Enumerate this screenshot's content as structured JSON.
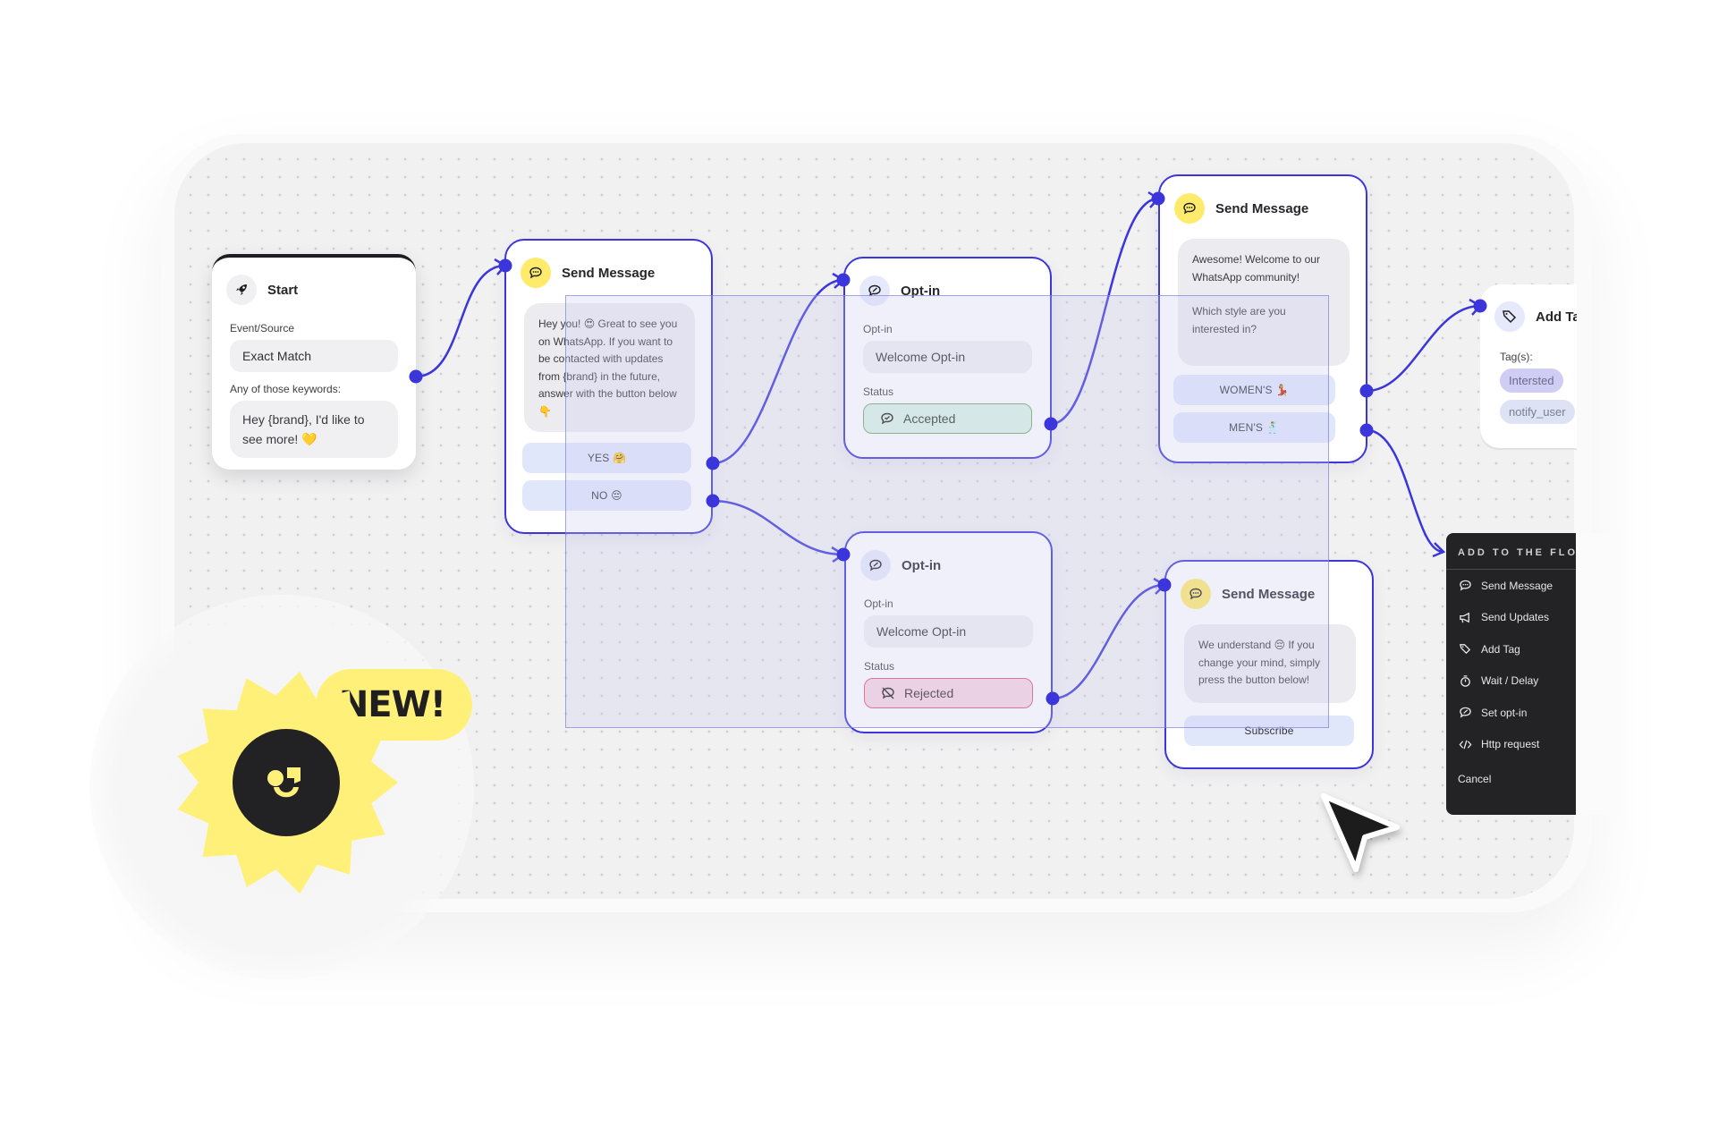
{
  "canvas": {
    "nodes": {
      "start": {
        "title": "Start",
        "icon": "rocket-icon",
        "event_label": "Event/Source",
        "event_value": "Exact Match",
        "keywords_label": "Any of those keywords:",
        "keyword_value": "Hey {brand}, I'd like to see more! 💛"
      },
      "send_message_1": {
        "title": "Send Message",
        "icon": "chat-bubble-icon",
        "message": "Hey you! 😍 Great to see you on WhatsApp. If you want to be contacted with updates from {brand} in the future, answer with the button below 👇",
        "buttons": [
          "YES 🤗",
          "NO 😔"
        ]
      },
      "optin_accepted": {
        "title": "Opt-in",
        "icon": "optin-icon",
        "optin_label": "Opt-in",
        "optin_value": "Welcome Opt-in",
        "status_label": "Status",
        "status_value": "Accepted",
        "status_color": "#dcf3e3"
      },
      "optin_rejected": {
        "title": "Opt-in",
        "icon": "optin-icon",
        "optin_label": "Opt-in",
        "optin_value": "Welcome Opt-in",
        "status_label": "Status",
        "status_value": "Rejected",
        "status_color": "#f7d4de"
      },
      "send_message_2": {
        "title": "Send Message",
        "icon": "chat-bubble-icon",
        "message_line1": "Awesome! Welcome to our WhatsApp community!",
        "message_line2": "Which style are you interested in?",
        "buttons": [
          "WOMEN'S 💃",
          "MEN'S 🕺"
        ]
      },
      "send_message_3": {
        "title": "Send Message",
        "icon": "chat-bubble-icon",
        "message": "We understand 😔 If you change your mind, simply press the button below!",
        "buttons": [
          "Subscribe"
        ]
      },
      "add_tag": {
        "title": "Add Tag",
        "icon": "tag-icon",
        "tags_label": "Tag(s):",
        "tags": [
          "Intersted",
          "notify_user"
        ]
      }
    }
  },
  "context_menu": {
    "title": "ADD TO THE FLOW",
    "items": [
      {
        "label": "Send Message",
        "icon": "chat-bubble-icon"
      },
      {
        "label": "Send Updates",
        "icon": "megaphone-icon"
      },
      {
        "label": "Add Tag",
        "icon": "tag-icon"
      },
      {
        "label": "Wait / Delay",
        "icon": "stopwatch-icon"
      },
      {
        "label": "Set opt-in",
        "icon": "optin-icon"
      },
      {
        "label": "Http request",
        "icon": "code-icon"
      }
    ],
    "cancel_label": "Cancel"
  },
  "badge": {
    "label": "NEW!",
    "color": "#fff07a"
  },
  "colors": {
    "accent": "#3b36db",
    "badge_yellow": "#fff07a",
    "menu_bg": "#232325"
  }
}
